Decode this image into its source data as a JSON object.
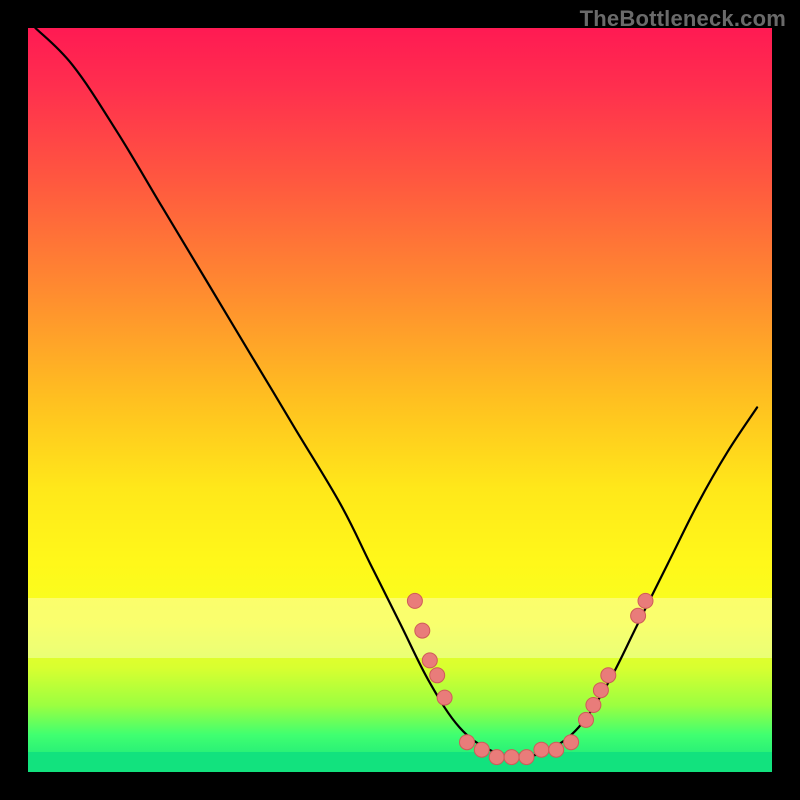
{
  "watermark": "TheBottleneck.com",
  "colors": {
    "dot_fill": "#e97c7a",
    "dot_stroke": "#cf5b59",
    "curve": "#000000",
    "frame": "#000000"
  },
  "chart_data": {
    "type": "line",
    "title": "",
    "xlabel": "",
    "ylabel": "",
    "xlim": [
      0,
      100
    ],
    "ylim": [
      0,
      100
    ],
    "curve": [
      {
        "x": 1,
        "y": 100
      },
      {
        "x": 6,
        "y": 95
      },
      {
        "x": 12,
        "y": 86
      },
      {
        "x": 18,
        "y": 76
      },
      {
        "x": 24,
        "y": 66
      },
      {
        "x": 30,
        "y": 56
      },
      {
        "x": 36,
        "y": 46
      },
      {
        "x": 42,
        "y": 36
      },
      {
        "x": 46,
        "y": 28
      },
      {
        "x": 50,
        "y": 20
      },
      {
        "x": 54,
        "y": 12
      },
      {
        "x": 58,
        "y": 6
      },
      {
        "x": 62,
        "y": 3
      },
      {
        "x": 66,
        "y": 2
      },
      {
        "x": 70,
        "y": 3
      },
      {
        "x": 74,
        "y": 6
      },
      {
        "x": 78,
        "y": 12
      },
      {
        "x": 82,
        "y": 20
      },
      {
        "x": 86,
        "y": 28
      },
      {
        "x": 90,
        "y": 36
      },
      {
        "x": 94,
        "y": 43
      },
      {
        "x": 98,
        "y": 49
      }
    ],
    "dots": [
      {
        "x": 52,
        "y": 23
      },
      {
        "x": 53,
        "y": 19
      },
      {
        "x": 54,
        "y": 15
      },
      {
        "x": 55,
        "y": 13
      },
      {
        "x": 56,
        "y": 10
      },
      {
        "x": 59,
        "y": 4
      },
      {
        "x": 61,
        "y": 3
      },
      {
        "x": 63,
        "y": 2
      },
      {
        "x": 65,
        "y": 2
      },
      {
        "x": 67,
        "y": 2
      },
      {
        "x": 69,
        "y": 3
      },
      {
        "x": 71,
        "y": 3
      },
      {
        "x": 73,
        "y": 4
      },
      {
        "x": 75,
        "y": 7
      },
      {
        "x": 76,
        "y": 9
      },
      {
        "x": 77,
        "y": 11
      },
      {
        "x": 78,
        "y": 13
      },
      {
        "x": 82,
        "y": 21
      },
      {
        "x": 83,
        "y": 23
      }
    ]
  }
}
